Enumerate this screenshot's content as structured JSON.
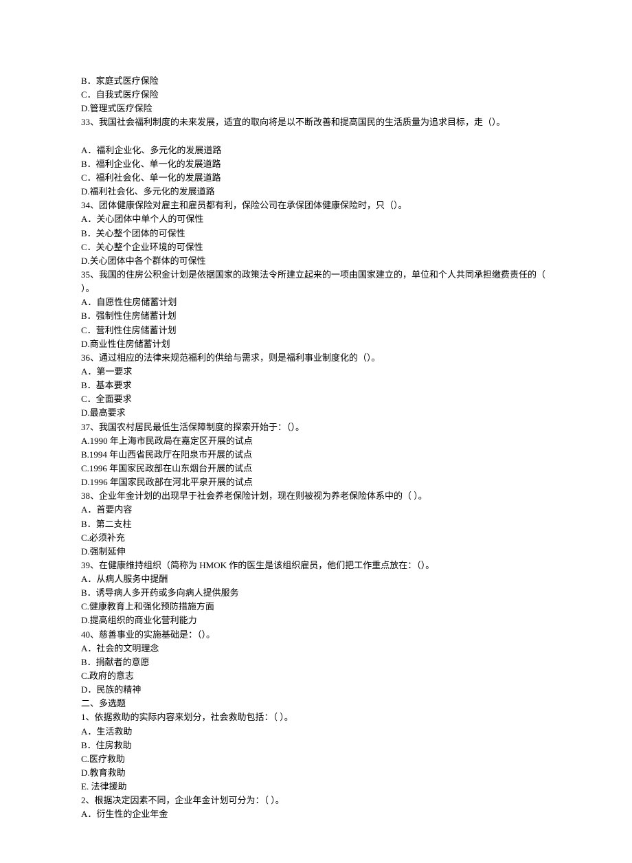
{
  "lines": [
    "B．家庭式医疗保险",
    "C．自我式医疗保险",
    "D.管理式医疗保险",
    "33、我国社会福利制度的未来发展，适宜的取向将是以不断改善和提高国民的生活质量为追求目标，走（）。",
    "",
    "A．福利企业化、多元化的发展道路",
    "B．福利企业化、单一化的发展道路",
    "C．福利社会化、单一化的发展道路",
    "D.福利社会化、多元化的发展道路",
    "34、团体健康保险对雇主和雇员都有利，保险公司在承保团体健康保险时，只（）。",
    "A．关心团体中单个人的可保性",
    "B．关心整个团体的可保性",
    "C．关心整个企业环境的可保性",
    "D.关心团体中各个群体的可保性",
    "35、我国的住房公积金计划是依据国家的政策法令所建立起来的一项由国家建立的，单位和个人共同承担缴费责任的（  ）。",
    "A．自愿性住房储蓄计划",
    "B．强制性住房储蓄计划",
    "C．营利性住房储蓄计划",
    "D.商业性住房储蓄计划",
    "36、通过相应的法律来规范福利的供给与需求，则是福利事业制度化的（）。",
    "A．第一要求",
    "B．基本要求",
    "C．全面要求",
    "D.最高要求",
    "37、我国农村居民最低生活保障制度的探索开始于：（）。",
    "A.1990 年上海市民政局在嘉定区开展的试点",
    "B.1994 年山西省民政厅在阳泉市开展的试点",
    "C.1996 年国家民政部在山东烟台开展的试点",
    "D.1996 年国家民政部在河北平泉开展的试点",
    "38、企业年金计划的出现早于社会养老保险计划，现在则被视为养老保险体系中的（  ）。",
    "A．首要内容",
    "B．第二支柱",
    "C.必须补充",
    "D.强制延伸",
    "39、在健康维持组织（简称为 HMOK 作的医生是该组织雇员，他们把工作重点放在：（）。",
    "A．从病人服务中提酬",
    "B．诱导病人多开药或多向病人提供服务",
    "C.健康教育上和强化预防措施方面",
    "D.提高组织的商业化营利能力",
    "40、慈善事业的实施基础是：（）。",
    "A．社会的文明理念",
    "B．捐献者的意愿",
    "C.政府的意志",
    "D．民族的精神",
    "二、多选题",
    "1、依据救助的实际内容来划分，社会救助包括：（  ）。",
    "A．生活救助",
    "B．住房救助",
    "C.医疗救助",
    "D.教育救助",
    "E. 法律援助",
    "2、根据决定因素不同，企业年金计划可分为：（  ）。",
    "A．衍生性的企业年金"
  ]
}
